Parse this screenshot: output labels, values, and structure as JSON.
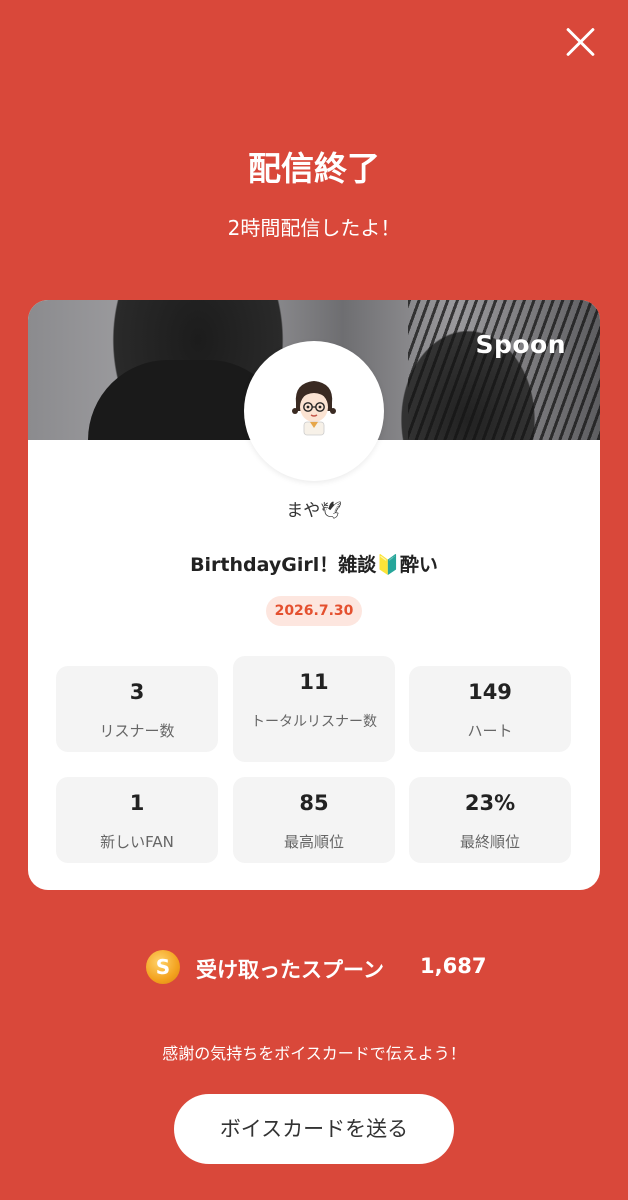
{
  "header": {
    "title": "配信終了",
    "subtitle": "2時間配信したよ！"
  },
  "card": {
    "brand": "Spoon",
    "nickname": "まや🕊",
    "live_title": "BirthdayGirl！雑談🔰酔い",
    "date": "2026.7.30",
    "stats": [
      {
        "value": "3",
        "label": "リスナー数"
      },
      {
        "value": "11",
        "label": "トータルリスナー数"
      },
      {
        "value": "149",
        "label": "ハート"
      },
      {
        "value": "1",
        "label": "新しいFAN"
      },
      {
        "value": "85",
        "label": "最高順位"
      },
      {
        "value": "23%",
        "label": "最終順位"
      }
    ]
  },
  "spoons": {
    "icon_letter": "S",
    "label": "受け取ったスプーン",
    "amount": "1,687"
  },
  "footer": {
    "thanks": "感謝の気持ちをボイスカードで伝えよう！",
    "send_button": "ボイスカードを送る"
  },
  "colors": {
    "background": "#d9483a",
    "accent": "#e4502f",
    "badge_bg": "#fde6df"
  }
}
